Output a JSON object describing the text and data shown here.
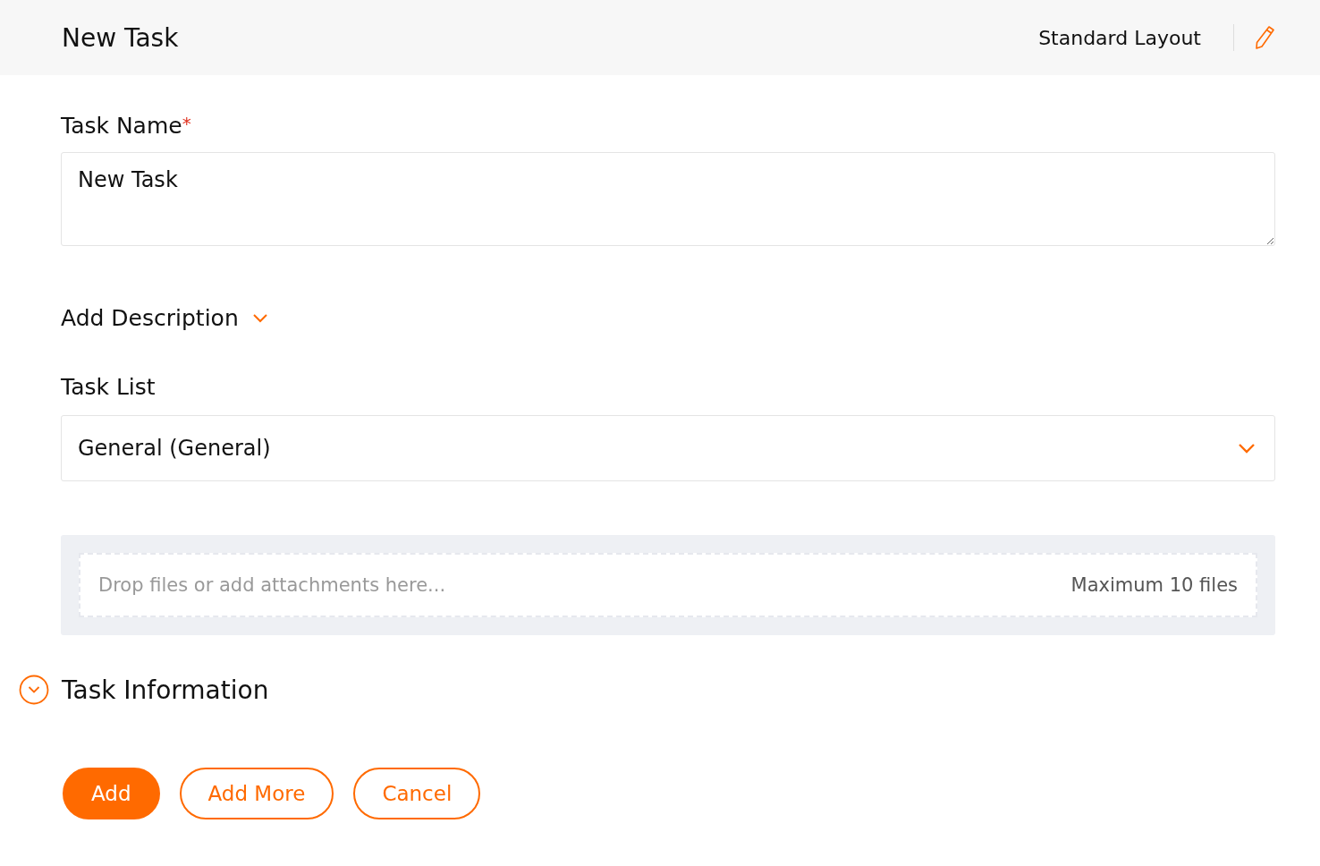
{
  "header": {
    "title": "New Task",
    "layout": "Standard Layout"
  },
  "task_name": {
    "label": "Task Name",
    "required_mark": "*",
    "value": "New Task"
  },
  "description": {
    "label": "Add Description",
    "expanded": false
  },
  "task_list": {
    "label": "Task List",
    "value": "General (General)"
  },
  "attachments": {
    "placeholder": "Drop files or add attachments here...",
    "limit": "Maximum 10 files"
  },
  "section": {
    "title": "Task Information",
    "expanded": false
  },
  "buttons": [
    {
      "label": "Add",
      "kind": "primary"
    },
    {
      "label": "Add More",
      "kind": "secondary"
    },
    {
      "label": "Cancel",
      "kind": "secondary"
    }
  ]
}
